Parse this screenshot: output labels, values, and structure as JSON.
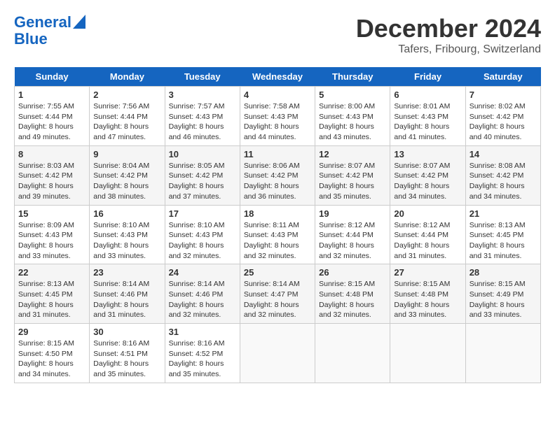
{
  "header": {
    "logo_line1": "General",
    "logo_line2": "Blue",
    "month_title": "December 2024",
    "subtitle": "Tafers, Fribourg, Switzerland"
  },
  "weekdays": [
    "Sunday",
    "Monday",
    "Tuesday",
    "Wednesday",
    "Thursday",
    "Friday",
    "Saturday"
  ],
  "weeks": [
    [
      {
        "day": "1",
        "content": "Sunrise: 7:55 AM\nSunset: 4:44 PM\nDaylight: 8 hours\nand 49 minutes."
      },
      {
        "day": "2",
        "content": "Sunrise: 7:56 AM\nSunset: 4:44 PM\nDaylight: 8 hours\nand 47 minutes."
      },
      {
        "day": "3",
        "content": "Sunrise: 7:57 AM\nSunset: 4:43 PM\nDaylight: 8 hours\nand 46 minutes."
      },
      {
        "day": "4",
        "content": "Sunrise: 7:58 AM\nSunset: 4:43 PM\nDaylight: 8 hours\nand 44 minutes."
      },
      {
        "day": "5",
        "content": "Sunrise: 8:00 AM\nSunset: 4:43 PM\nDaylight: 8 hours\nand 43 minutes."
      },
      {
        "day": "6",
        "content": "Sunrise: 8:01 AM\nSunset: 4:43 PM\nDaylight: 8 hours\nand 41 minutes."
      },
      {
        "day": "7",
        "content": "Sunrise: 8:02 AM\nSunset: 4:42 PM\nDaylight: 8 hours\nand 40 minutes."
      }
    ],
    [
      {
        "day": "8",
        "content": "Sunrise: 8:03 AM\nSunset: 4:42 PM\nDaylight: 8 hours\nand 39 minutes."
      },
      {
        "day": "9",
        "content": "Sunrise: 8:04 AM\nSunset: 4:42 PM\nDaylight: 8 hours\nand 38 minutes."
      },
      {
        "day": "10",
        "content": "Sunrise: 8:05 AM\nSunset: 4:42 PM\nDaylight: 8 hours\nand 37 minutes."
      },
      {
        "day": "11",
        "content": "Sunrise: 8:06 AM\nSunset: 4:42 PM\nDaylight: 8 hours\nand 36 minutes."
      },
      {
        "day": "12",
        "content": "Sunrise: 8:07 AM\nSunset: 4:42 PM\nDaylight: 8 hours\nand 35 minutes."
      },
      {
        "day": "13",
        "content": "Sunrise: 8:07 AM\nSunset: 4:42 PM\nDaylight: 8 hours\nand 34 minutes."
      },
      {
        "day": "14",
        "content": "Sunrise: 8:08 AM\nSunset: 4:42 PM\nDaylight: 8 hours\nand 34 minutes."
      }
    ],
    [
      {
        "day": "15",
        "content": "Sunrise: 8:09 AM\nSunset: 4:43 PM\nDaylight: 8 hours\nand 33 minutes."
      },
      {
        "day": "16",
        "content": "Sunrise: 8:10 AM\nSunset: 4:43 PM\nDaylight: 8 hours\nand 33 minutes."
      },
      {
        "day": "17",
        "content": "Sunrise: 8:10 AM\nSunset: 4:43 PM\nDaylight: 8 hours\nand 32 minutes."
      },
      {
        "day": "18",
        "content": "Sunrise: 8:11 AM\nSunset: 4:43 PM\nDaylight: 8 hours\nand 32 minutes."
      },
      {
        "day": "19",
        "content": "Sunrise: 8:12 AM\nSunset: 4:44 PM\nDaylight: 8 hours\nand 32 minutes."
      },
      {
        "day": "20",
        "content": "Sunrise: 8:12 AM\nSunset: 4:44 PM\nDaylight: 8 hours\nand 31 minutes."
      },
      {
        "day": "21",
        "content": "Sunrise: 8:13 AM\nSunset: 4:45 PM\nDaylight: 8 hours\nand 31 minutes."
      }
    ],
    [
      {
        "day": "22",
        "content": "Sunrise: 8:13 AM\nSunset: 4:45 PM\nDaylight: 8 hours\nand 31 minutes."
      },
      {
        "day": "23",
        "content": "Sunrise: 8:14 AM\nSunset: 4:46 PM\nDaylight: 8 hours\nand 31 minutes."
      },
      {
        "day": "24",
        "content": "Sunrise: 8:14 AM\nSunset: 4:46 PM\nDaylight: 8 hours\nand 32 minutes."
      },
      {
        "day": "25",
        "content": "Sunrise: 8:14 AM\nSunset: 4:47 PM\nDaylight: 8 hours\nand 32 minutes."
      },
      {
        "day": "26",
        "content": "Sunrise: 8:15 AM\nSunset: 4:48 PM\nDaylight: 8 hours\nand 32 minutes."
      },
      {
        "day": "27",
        "content": "Sunrise: 8:15 AM\nSunset: 4:48 PM\nDaylight: 8 hours\nand 33 minutes."
      },
      {
        "day": "28",
        "content": "Sunrise: 8:15 AM\nSunset: 4:49 PM\nDaylight: 8 hours\nand 33 minutes."
      }
    ],
    [
      {
        "day": "29",
        "content": "Sunrise: 8:15 AM\nSunset: 4:50 PM\nDaylight: 8 hours\nand 34 minutes."
      },
      {
        "day": "30",
        "content": "Sunrise: 8:16 AM\nSunset: 4:51 PM\nDaylight: 8 hours\nand 35 minutes."
      },
      {
        "day": "31",
        "content": "Sunrise: 8:16 AM\nSunset: 4:52 PM\nDaylight: 8 hours\nand 35 minutes."
      },
      {
        "day": "",
        "content": ""
      },
      {
        "day": "",
        "content": ""
      },
      {
        "day": "",
        "content": ""
      },
      {
        "day": "",
        "content": ""
      }
    ]
  ]
}
